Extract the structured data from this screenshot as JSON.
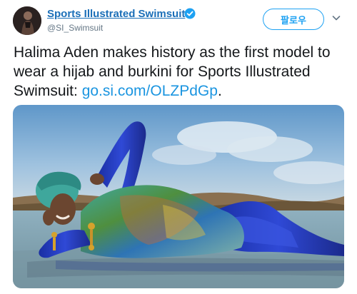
{
  "tweet": {
    "author": {
      "display_name": "Sports Illustrated Swimsuit",
      "handle": "@SI_Swimsuit",
      "verified": true,
      "avatar_icon": "profile-photo"
    },
    "follow_label": "팔로우",
    "menu_icon": "chevron-down-icon",
    "text": "Halima Aden makes history as the first model to wear a hijab and burkini for Sports Illustrated Swimsuit: ",
    "link_text": "go.si.com/OLZPdGp",
    "text_end": ".",
    "media_icon": "beach-photo"
  },
  "colors": {
    "name_blue": "#1b6fb8",
    "link_blue": "#1b95e0",
    "verified_blue": "#1da1f2",
    "muted_gray": "#657786"
  }
}
